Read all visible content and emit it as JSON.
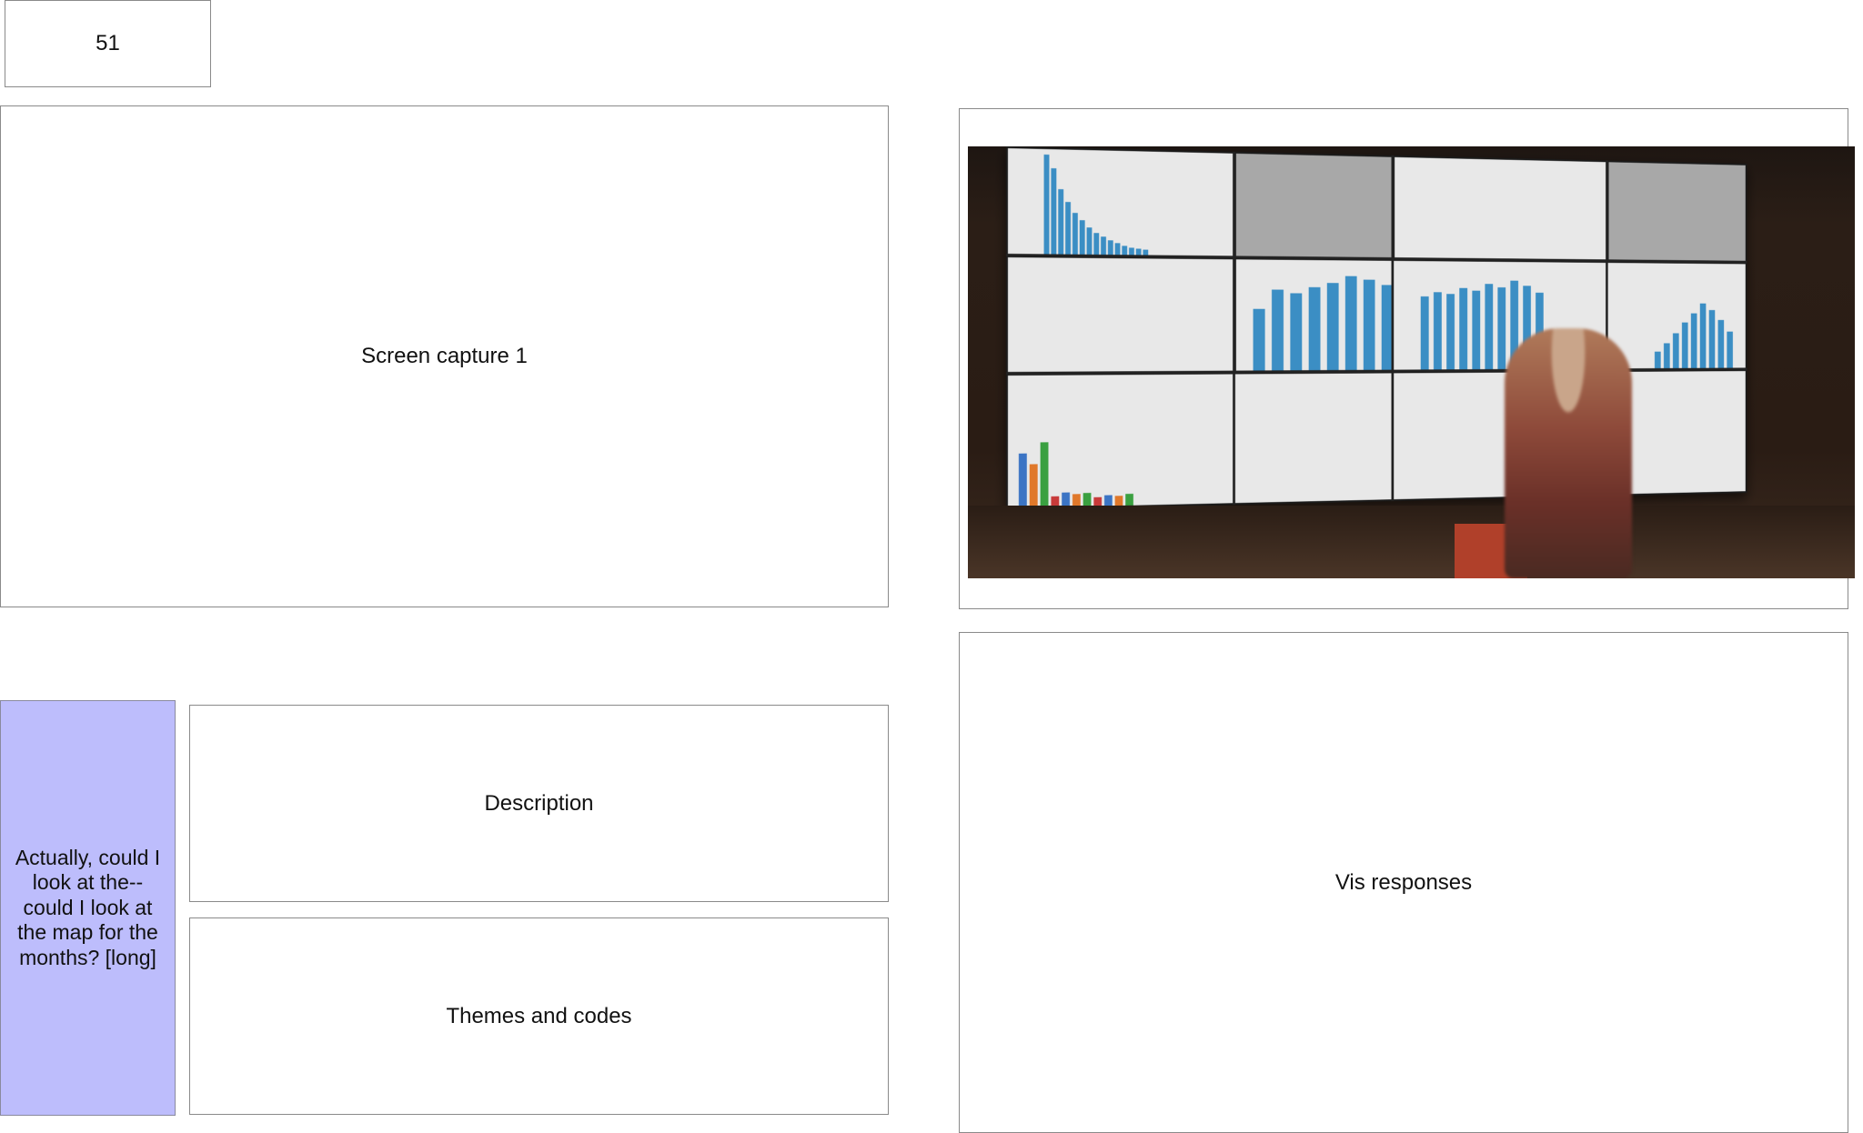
{
  "page_number": "51",
  "screen_capture_label": "Screen capture 1",
  "quote": "Actually, could I look at the-- could I look at the map for the months? [long]",
  "description_label": "Description",
  "themes_label": "Themes and codes",
  "vis_responses_label": "Vis responses",
  "colors": {
    "quote_bg": "#bdbdfc",
    "border": "#8a8a8a",
    "chart_blue": "#3b8ec4"
  }
}
